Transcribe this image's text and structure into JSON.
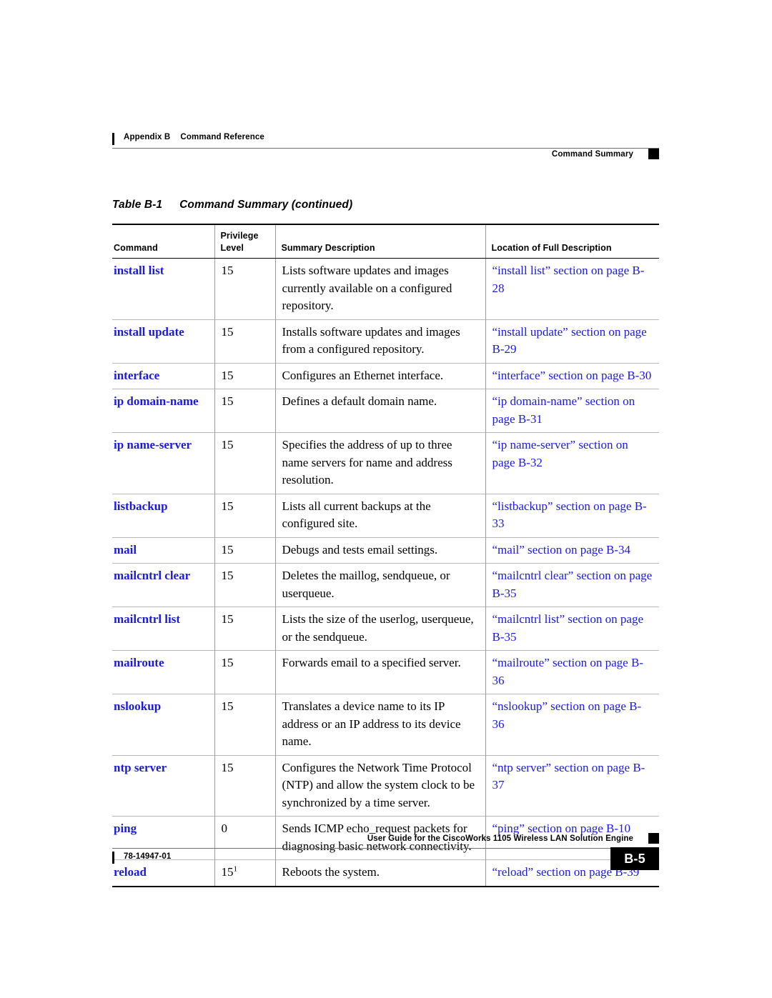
{
  "running_head": {
    "left_label": "Appendix B",
    "left_title": "Command Reference",
    "right_title": "Command Summary"
  },
  "table_caption": {
    "number": "Table B-1",
    "title": "Command Summary (continued)"
  },
  "table": {
    "headers": {
      "command": "Command",
      "privilege_line1": "Privilege",
      "privilege_line2": "Level",
      "summary": "Summary Description",
      "location": "Location of Full Description"
    },
    "rows": [
      {
        "command": "install list",
        "level": "15",
        "level_note": "",
        "summary": "Lists software updates and images currently available on a configured repository.",
        "location": "“install list” section on page B-28"
      },
      {
        "command": "install update",
        "level": "15",
        "level_note": "",
        "summary": "Installs software updates and images from a configured repository.",
        "location": "“install update” section on page B-29"
      },
      {
        "command": "interface",
        "level": "15",
        "level_note": "",
        "summary": "Configures an Ethernet interface.",
        "location": "“interface” section on page B-30"
      },
      {
        "command": "ip domain-name",
        "level": "15",
        "level_note": "",
        "summary": "Defines a default domain name.",
        "location": "“ip domain-name” section on page B-31"
      },
      {
        "command": "ip name-server",
        "level": "15",
        "level_note": "",
        "summary": "Specifies the address of up to three name servers for name and address resolution.",
        "location": "“ip name-server” section on page B-32"
      },
      {
        "command": "listbackup",
        "level": "15",
        "level_note": "",
        "summary": "Lists all current backups at the configured site.",
        "location": "“listbackup” section on page B-33"
      },
      {
        "command": "mail",
        "level": "15",
        "level_note": "",
        "summary": "Debugs and tests email settings.",
        "location": "“mail” section on page B-34"
      },
      {
        "command": "mailcntrl clear",
        "level": "15",
        "level_note": "",
        "summary": "Deletes the maillog, sendqueue, or userqueue.",
        "location": "“mailcntrl clear” section on page B-35"
      },
      {
        "command": "mailcntrl list",
        "level": "15",
        "level_note": "",
        "summary": "Lists the size of the userlog, userqueue, or the sendqueue.",
        "location": "“mailcntrl list” section on page B-35"
      },
      {
        "command": "mailroute",
        "level": "15",
        "level_note": "",
        "summary": "Forwards email to a specified server.",
        "location": "“mailroute” section on page B-36"
      },
      {
        "command": "nslookup",
        "level": "15",
        "level_note": "",
        "summary": "Translates a device name to its IP address or an IP address to its device name.",
        "location": "“nslookup” section on page B-36"
      },
      {
        "command": "ntp server",
        "level": "15",
        "level_note": "",
        "summary": "Configures the Network Time Protocol (NTP) and allow the system clock to be synchronized by a time server.",
        "location": "“ntp server” section on page B-37"
      },
      {
        "command": "ping",
        "level": "0",
        "level_note": "",
        "summary": "Sends ICMP echo_request packets for diagnosing basic network connectivity.",
        "location": "“ping” section on page B-10"
      },
      {
        "command": "reload",
        "level": "15",
        "level_note": "1",
        "summary": "Reboots the system.",
        "location": "“reload” section on page B-39"
      }
    ]
  },
  "footer": {
    "guide_title": "User Guide for the CiscoWorks 1105 Wireless LAN Solution Engine",
    "doc_number": "78-14947-01",
    "page_number": "B-5"
  },
  "colors": {
    "link_blue": "#1a1ae0",
    "rule_gray": "#6f6f6f",
    "row_divider": "#b8b8b8"
  }
}
